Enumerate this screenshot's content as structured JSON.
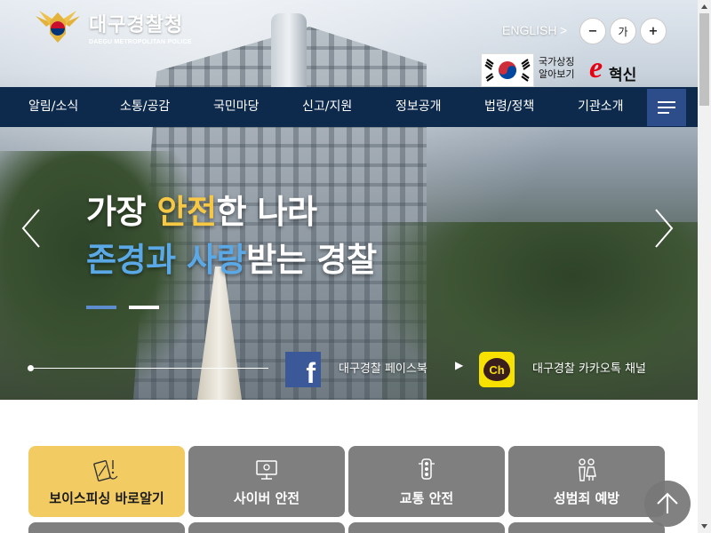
{
  "header": {
    "logo_title": "대구경찰청",
    "logo_subtitle": "DAEGU METROPOLITAN POLICE",
    "language_link": "ENGLISH",
    "language_arrow": ">",
    "font_controls": {
      "decrease": "−",
      "default": "가",
      "increase": "+"
    },
    "flag_label_line1": "국가상징",
    "flag_label_line2": "알아보기",
    "innovation_logo_e": "e",
    "innovation_logo_text": "혁신"
  },
  "nav": {
    "items": [
      "알림/소식",
      "소통/공감",
      "국민마당",
      "신고/지원",
      "정보공개",
      "법령/정책",
      "기관소개"
    ]
  },
  "hero": {
    "line1_pre": "가장 ",
    "line1_highlight": "안전",
    "line1_post": "한 나라",
    "line2_highlight": "존경과 사랑",
    "line2_post": "받는 경찰",
    "highlight_colors": {
      "yellow": "#f7c844",
      "blue": "#5aa9e6"
    },
    "slide_count": 2,
    "active_slide": 1
  },
  "social": {
    "facebook_label": "대구경찰 페이스북",
    "facebook_arrow": "▶",
    "facebook_glyph": "f",
    "kakao_label": "대구경찰 카카오톡 채널",
    "kakao_glyph": "Ch"
  },
  "quick_tiles": [
    {
      "label": "보이스피싱 바로알기",
      "icon": "phone-warning-icon",
      "active": true
    },
    {
      "label": "사이버 안전",
      "icon": "monitor-icon",
      "active": false
    },
    {
      "label": "교통 안전",
      "icon": "traffic-light-icon",
      "active": false
    },
    {
      "label": "성범죄 예방",
      "icon": "people-icon",
      "active": false
    }
  ],
  "colors": {
    "nav_bg": "#0d2a4d",
    "menu_button_bg": "#2c4c8a",
    "tile_default": "#7f7f7f",
    "tile_active": "#f2cc63",
    "facebook": "#3b5998",
    "kakao": "#f7e100",
    "brand_red": "#e60012"
  }
}
